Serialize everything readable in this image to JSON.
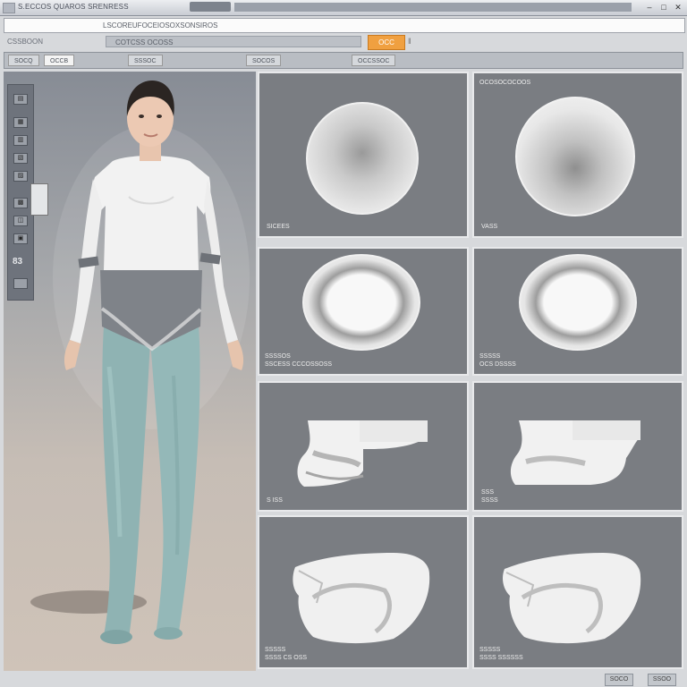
{
  "window": {
    "title": "S.ECCOS QUAROS SRENRESS",
    "min_label": "–",
    "max_label": "□",
    "close_label": "✕"
  },
  "addressbar": {
    "text": "LSCOREUFOCEIOSOXSONSIROS"
  },
  "toolbar": {
    "label": "CSSBOON",
    "field_text": "COTCSS OCOSS",
    "button_label": "OCC",
    "separator": "‖"
  },
  "tabs": [
    {
      "label": "SOCQ",
      "active": false
    },
    {
      "label": "OCCB",
      "active": true
    },
    {
      "label": "SSSOC",
      "active": false
    },
    {
      "label": "SOCOS",
      "active": false
    },
    {
      "label": "OCCSSOC",
      "active": false
    }
  ],
  "sidepanel": {
    "icons": [
      "▤",
      "▦",
      "▥",
      "▧",
      "▨",
      "▩",
      "◫",
      "▣"
    ],
    "number": "83"
  },
  "panels": {
    "p1": {
      "top": "",
      "bottom": "SICEES"
    },
    "p2": {
      "top": "OCOSOCOCOOS",
      "bottom": "VASS"
    },
    "p3": {
      "top": "",
      "bottom": "SSSSOS\nSSCESS CCCOSSOSS"
    },
    "p4": {
      "top": "",
      "bottom": "SSSSS\nOCS DSSSS"
    },
    "p5": {
      "top": "",
      "bottom": "S ISS"
    },
    "p6": {
      "top": "",
      "bottom": "SSS\nSSSS"
    },
    "p7": {
      "top": "",
      "bottom": "SSSSS\nSSSS CS OSS"
    },
    "p8": {
      "top": "",
      "bottom": "SSSSS\nSSSS SSSSSS"
    }
  },
  "footer": {
    "btn1": "SOCO",
    "btn2": "SSOO"
  },
  "colors": {
    "accent": "#f0a040",
    "panel_bg": "#7a7d82",
    "leggings": "#8fb3b3"
  }
}
